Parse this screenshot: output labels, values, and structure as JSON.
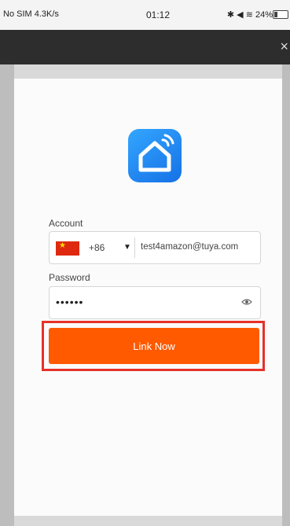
{
  "status_bar": {
    "carrier": "No SIM 4.3K/s",
    "time": "01:12",
    "battery": "24%"
  },
  "header": {
    "close_glyph": "×"
  },
  "login": {
    "account_label": "Account",
    "country_code": "+86",
    "account_value": "test4amazon@tuya.com",
    "password_label": "Password",
    "password_masked": "••••••",
    "link_button": "Link Now"
  },
  "icons": [
    "app-logo-icon",
    "china-flag-icon",
    "dropdown-caret-icon",
    "eye-icon",
    "close-icon"
  ],
  "colors": {
    "logo_blue": "#1671e6",
    "button_orange": "#ff5a00",
    "highlight_red": "#e6312a"
  }
}
